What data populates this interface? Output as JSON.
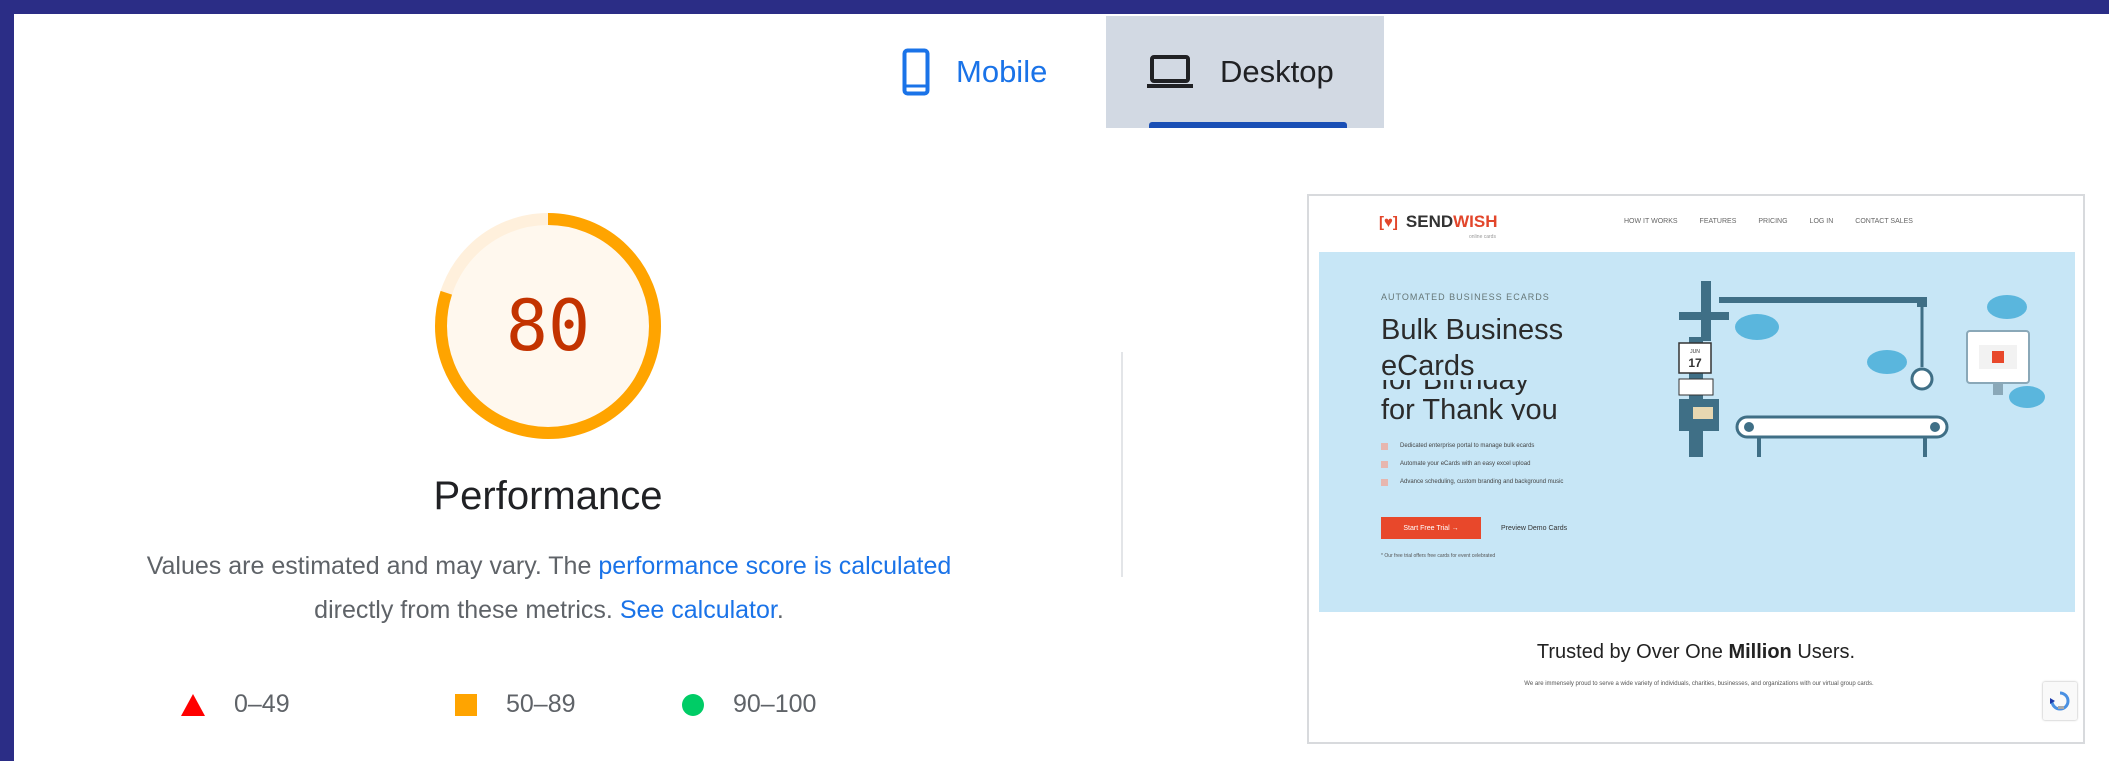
{
  "tabs": {
    "mobile_label": "Mobile",
    "desktop_label": "Desktop",
    "selected": "Desktop"
  },
  "gauge": {
    "score": "80",
    "score_fraction": 0.8,
    "category": "Performance"
  },
  "description": {
    "text_before": "Values are estimated and may vary. The ",
    "link_score": "performance score is calculated",
    "text_middle": " directly from these metrics. ",
    "link_calculator": "See calculator",
    "text_after": "."
  },
  "legend": {
    "fail": "0–49",
    "average": "50–89",
    "pass": "90–100"
  },
  "screenshot": {
    "logo_send": "SEND",
    "logo_wish": "WISH",
    "logo_tagline": "online cards",
    "nav": [
      "HOW IT WORKS",
      "FEATURES",
      "PRICING",
      "LOG IN",
      "CONTACT SALES"
    ],
    "eyebrow": "AUTOMATED BUSINESS ECARDS",
    "title": "Bulk Business eCards",
    "rotator_prev": "for Birthday",
    "rotator_next": "for Thank you",
    "bullets": [
      "Dedicated enterprise portal to manage bulk ecards",
      "Automate your eCards with an easy excel upload",
      "Advance scheduling, custom branding and background music"
    ],
    "cta_primary": "Start Free Trial →",
    "cta_secondary": "Preview Demo Cards",
    "footnote": "* Our free trial offers free cards for event celebrated",
    "calendar_month": "JUN",
    "calendar_day": "17",
    "trust_prefix": "Trusted by Over One ",
    "trust_bold": "Million",
    "trust_suffix": " Users.",
    "trust_body": "We are immensely proud to serve a wide variety of individuals, charities, businesses, and organizations with our virtual group cards."
  },
  "colors": {
    "score_average": "#ffa400",
    "score_text": "#c33300",
    "fail": "#ff0000",
    "average": "#ffa400",
    "pass": "#00cc66",
    "link": "#1a73e8"
  }
}
